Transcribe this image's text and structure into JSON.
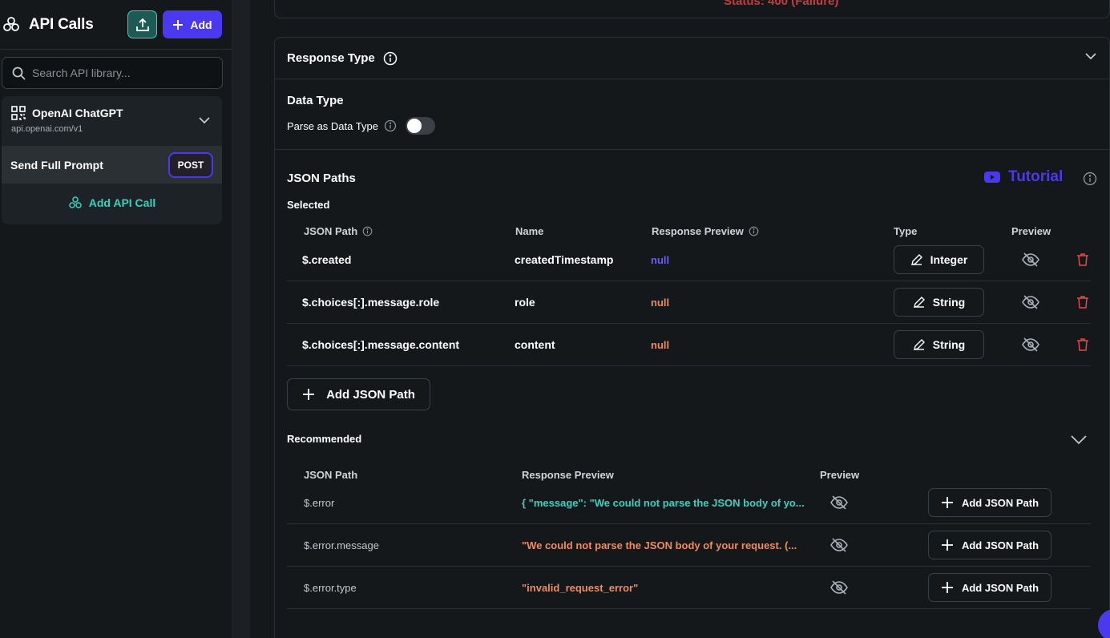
{
  "sidebar": {
    "title": "API Calls",
    "add_label": "Add",
    "search_placeholder": "Search API library...",
    "library": {
      "name": "OpenAI ChatGPT",
      "url": "api.openai.com/v1",
      "call": {
        "name": "Send Full Prompt",
        "method": "POST"
      },
      "add_call_label": "Add API Call"
    }
  },
  "main": {
    "status_text": "Status: 400 (Failure)",
    "response_type_title": "Response Type",
    "data_type": {
      "title": "Data Type",
      "parse_label": "Parse as Data Type",
      "parse_enabled": false
    },
    "json_paths": {
      "title": "JSON Paths",
      "tutorial_label": "Tutorial",
      "selected_label": "Selected",
      "headers": {
        "path": "JSON Path",
        "name": "Name",
        "preview": "Response Preview",
        "type": "Type",
        "preview_toggle": "Preview"
      },
      "rows": [
        {
          "path": "$.created",
          "name": "createdTimestamp",
          "value": "null",
          "type": "Integer"
        },
        {
          "path": "$.choices[:].message.role",
          "name": "role",
          "value": "null",
          "type": "String"
        },
        {
          "path": "$.choices[:].message.content",
          "name": "content",
          "value": "null",
          "type": "String"
        }
      ],
      "add_label": "Add JSON Path"
    },
    "recommended": {
      "title": "Recommended",
      "headers": {
        "path": "JSON Path",
        "preview": "Response Preview",
        "preview_toggle": "Preview"
      },
      "rows": [
        {
          "path": "$.error",
          "value": "{  \"message\": \"We could not parse the JSON body of yo...",
          "add_label": "Add JSON Path"
        },
        {
          "path": "$.error.message",
          "value": "\"We could not parse the JSON body of your request. (...",
          "add_label": "Add JSON Path"
        },
        {
          "path": "$.error.type",
          "value": "\"invalid_request_error\"",
          "add_label": "Add JSON Path"
        }
      ]
    }
  },
  "colors": {
    "accent": "#4b39ef",
    "teal": "#39d2c0",
    "orange": "#ee8b60",
    "error": "#c43d3d",
    "background": "#14181b"
  }
}
